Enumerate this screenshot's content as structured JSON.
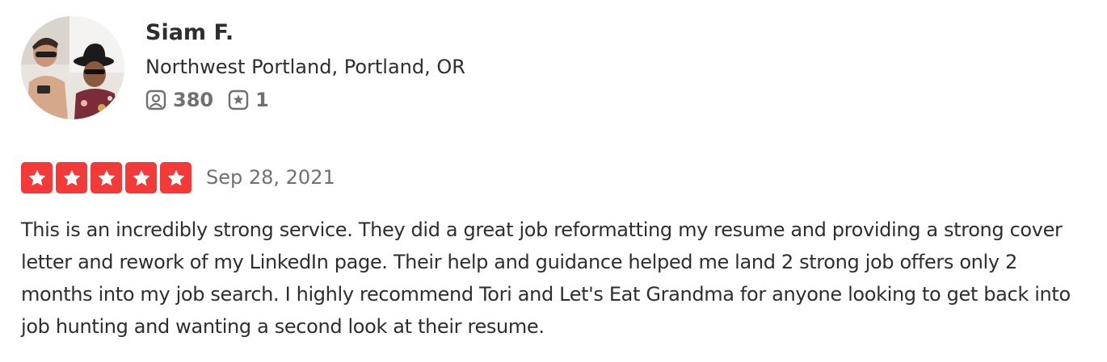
{
  "user": {
    "name": "Siam F.",
    "location": "Northwest Portland, Portland, OR",
    "review_count": "380",
    "photo_count": "1"
  },
  "review": {
    "rating": 5,
    "date": "Sep 28, 2021",
    "text": "This is an incredibly strong service. They did a great job reformatting my resume and providing a strong cover letter and rework of my LinkedIn page. Their help and guidance helped me land 2 strong job offers only 2 months into my job search. I highly recommend Tori and Let's Eat Grandma for anyone looking to get back into job hunting and wanting a second look at their resume."
  },
  "colors": {
    "star_fill": "#f43939",
    "text_primary": "#2d2e2f",
    "text_secondary": "#6e7072"
  },
  "icons": {
    "reviews": "review-count-icon",
    "photos": "photo-star-icon",
    "star": "star-icon"
  }
}
